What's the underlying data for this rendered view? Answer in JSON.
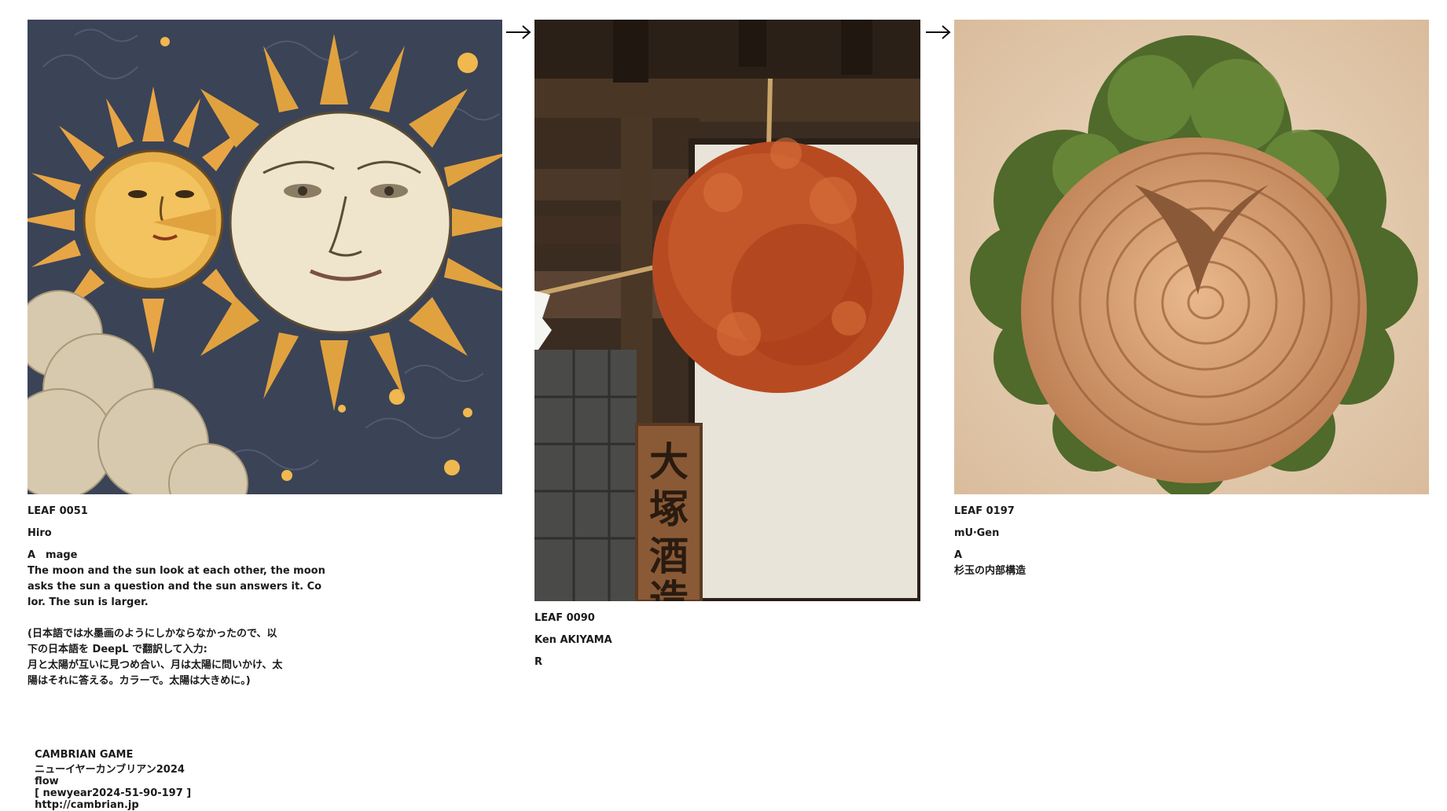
{
  "leaves": [
    {
      "id": "LEAF 0051",
      "author": "Hiro",
      "type": "A　mage",
      "description": "The moon and the sun look at each other, the moon\nasks the sun a question and the sun answers it. Co\nlor. The sun is larger.",
      "note": "(日本語では水墨画のようにしかならなかったので、以\n下の日本語を DeepL で翻訳して入力:\n月と太陽が互いに見つめ合い、月は太陽に問いかけ、太\n陽はそれに答える。カラーで。太陽は大きめに。)"
    },
    {
      "id": "LEAF 0090",
      "author": "Ken AKIYAMA",
      "type": "R",
      "sign_text": "大塚酒造"
    },
    {
      "id": "LEAF 0197",
      "author": "mU‧Gen",
      "type": "A",
      "description": "杉玉の内部構造"
    }
  ],
  "footer": {
    "game": "CAMBRIAN GAME",
    "title": "ニューイヤーカンブリアン2024",
    "flow_label": "flow",
    "flow_code": "[ newyear2024-51-90-197 ]",
    "url": "http://cambrian.jp"
  },
  "icons": [
    "flow-arrow-icon",
    "flow-arrow-icon"
  ]
}
